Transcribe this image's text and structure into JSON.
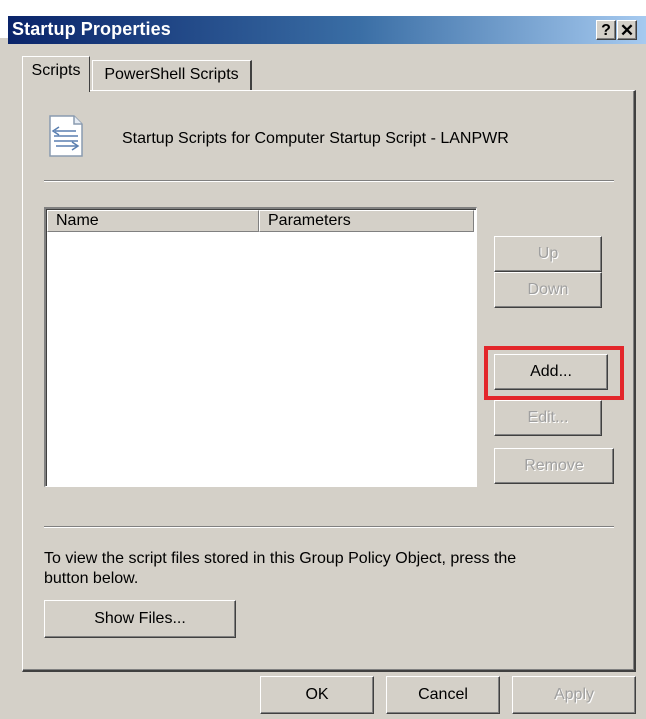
{
  "window": {
    "title": "Startup Properties",
    "help_glyph": "?",
    "close_glyph": "✕"
  },
  "tabs": [
    {
      "label": "Scripts",
      "selected": true
    },
    {
      "label": "PowerShell Scripts",
      "selected": false
    }
  ],
  "scripts_tab": {
    "icon": "script-file-icon",
    "heading": "Startup Scripts for Computer Startup Script - LANPWR",
    "list": {
      "columns": [
        "Name",
        "Parameters"
      ],
      "rows": []
    },
    "buttons": {
      "up": "Up",
      "down": "Down",
      "add": "Add...",
      "edit": "Edit...",
      "remove": "Remove"
    },
    "info_text": "To view the script files stored in this Group Policy Object, press the button below.",
    "show_files": "Show Files..."
  },
  "footer": {
    "ok": "OK",
    "cancel": "Cancel",
    "apply": "Apply"
  },
  "colors": {
    "highlight": "#e3262b",
    "titlebar_start": "#0a246a",
    "titlebar_end": "#a6caf0",
    "dialog_face": "#d4d0c8"
  }
}
